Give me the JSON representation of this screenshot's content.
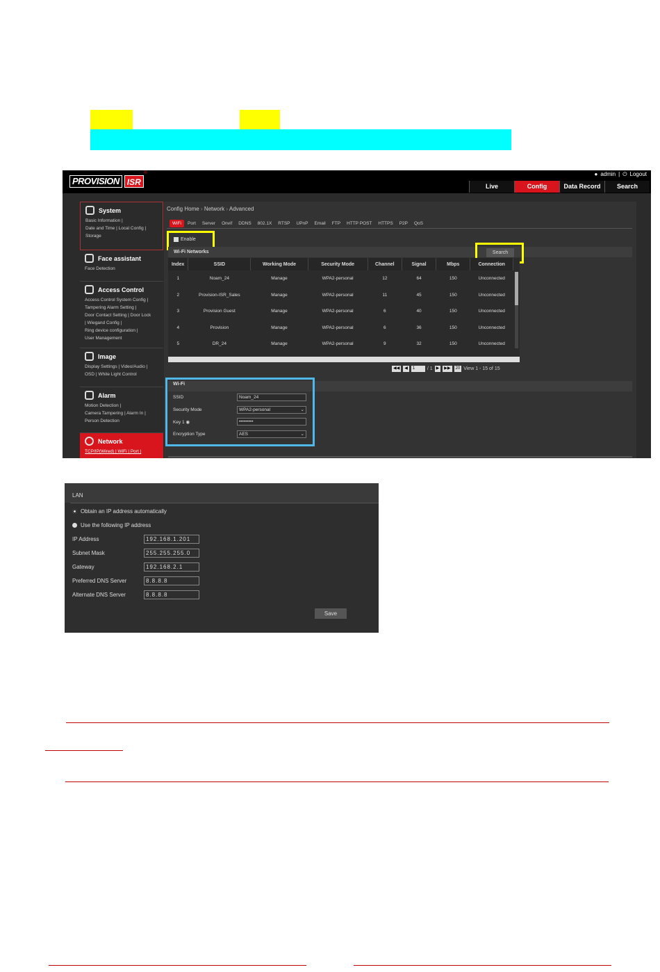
{
  "header": {
    "user_label": "admin",
    "separator": "|",
    "logout_label": "Logout",
    "nav_tabs": [
      "Live",
      "Config",
      "Data Record",
      "Search"
    ],
    "active_tab": "Config"
  },
  "logo": {
    "text": "PROVISION",
    "badge": "ISR",
    "mark": "®"
  },
  "sidebar": {
    "sections": [
      {
        "title": "System",
        "icon": "gear-icon",
        "links": [
          "Basic Information |",
          "Date and Time | Local Config |",
          "Storage"
        ]
      },
      {
        "title": "Face assistant",
        "icon": "face-icon",
        "links": [
          "Face Detection"
        ]
      },
      {
        "title": "Access Control",
        "icon": "lock-icon",
        "links": [
          "Access Control System Config |",
          "Tampering Alarm Setting |",
          "Door Contact Setting | Door Lock",
          " | Wiegand Config |",
          "Ring device configuration |",
          "User Management"
        ]
      },
      {
        "title": "Image",
        "icon": "image-icon",
        "links": [
          "Display Settings | Video/Audio |",
          "OSD | White Light Control"
        ]
      },
      {
        "title": "Alarm",
        "icon": "alarm-icon",
        "links": [
          "Motion Detection |",
          "Camera Tampering | Alarm In |",
          "Person Detection"
        ]
      },
      {
        "title": "Network",
        "icon": "globe-icon",
        "links": [
          "TCP/IP(Wired) | WiFi | Port |"
        ]
      }
    ]
  },
  "breadcrumb": [
    "Config Home",
    "Network",
    "Advanced"
  ],
  "breadcrumb_sep": "›",
  "subtabs": [
    "WiFi",
    "Port",
    "Server",
    "Onvif",
    "DDNS",
    "802.1X",
    "RTSP",
    "UPnP",
    "Email",
    "FTP",
    "HTTP POST",
    "HTTPS",
    "P2P",
    "QoS"
  ],
  "enable_label": "Enable",
  "wifi_networks": {
    "title": "Wi-Fi Networks",
    "search_label": "Search",
    "columns": [
      "Index",
      "SSID",
      "Working Mode",
      "Security Mode",
      "Channel",
      "Signal",
      "Mbps",
      "Connection"
    ],
    "rows": [
      [
        "1",
        "Noam_24",
        "Manage",
        "WPA2-personal",
        "12",
        "64",
        "150",
        "Unconnected"
      ],
      [
        "2",
        "Provision-ISR_Sales",
        "Manage",
        "WPA2-personal",
        "11",
        "45",
        "150",
        "Unconnected"
      ],
      [
        "3",
        "Provision Guest",
        "Manage",
        "WPA2-personal",
        "6",
        "40",
        "150",
        "Unconnected"
      ],
      [
        "4",
        "Provision",
        "Manage",
        "WPA2-personal",
        "6",
        "36",
        "150",
        "Unconnected"
      ],
      [
        "5",
        "DR_24",
        "Manage",
        "WPA2-personal",
        "9",
        "32",
        "150",
        "Unconnected"
      ]
    ],
    "pager": {
      "page": "1",
      "total": "/ 1",
      "per_page": "20",
      "view": "View 1 - 15 of 15"
    }
  },
  "wifi_form": {
    "title": "Wi-Fi",
    "ssid_label": "SSID",
    "ssid_value": "Noam_24",
    "security_label": "Security Mode",
    "security_value": "WPA2-personal",
    "key_label": "Key 1",
    "key_value": "•••••••••",
    "encryption_label": "Encryption Type",
    "encryption_value": "AES"
  },
  "lan": {
    "title": "LAN",
    "auto_label": "Obtain an IP address automatically",
    "manual_label": "Use the following IP address",
    "fields": [
      {
        "label": "IP Address",
        "value": "192.168.1.201"
      },
      {
        "label": "Subnet Mask",
        "value": "255.255.255.0"
      },
      {
        "label": "Gateway",
        "value": "192.168.2.1"
      },
      {
        "label": "Preferred DNS Server",
        "value": "8.8.8.8"
      },
      {
        "label": "Alternate DNS Server",
        "value": "8.8.8.8"
      }
    ],
    "save_label": "Save"
  },
  "colors": {
    "accent": "#d8141c",
    "highlight_yellow": "#ffff00",
    "highlight_cyan": "#00ffff",
    "box_blue": "#4fb8e9",
    "rule_red": "#c00000"
  }
}
